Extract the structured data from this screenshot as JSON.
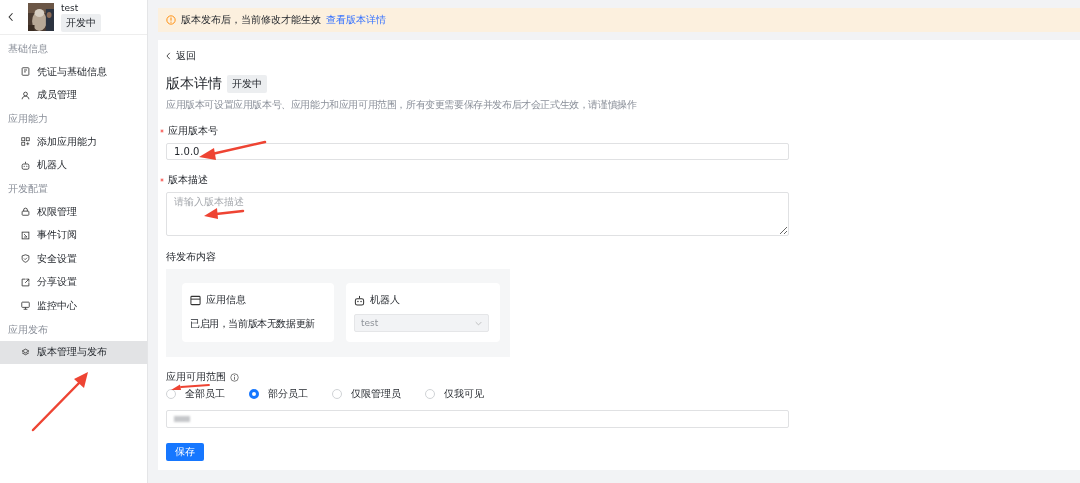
{
  "app": {
    "name": "test",
    "status": "开发中"
  },
  "sidebar": {
    "sections": [
      {
        "title": "基础信息",
        "items": [
          {
            "label": "凭证与基础信息",
            "selected": false
          },
          {
            "label": "成员管理",
            "selected": false
          }
        ]
      },
      {
        "title": "应用能力",
        "items": [
          {
            "label": "添加应用能力",
            "selected": false
          },
          {
            "label": "机器人",
            "selected": false
          }
        ]
      },
      {
        "title": "开发配置",
        "items": [
          {
            "label": "权限管理",
            "selected": false
          },
          {
            "label": "事件订阅",
            "selected": false
          },
          {
            "label": "安全设置",
            "selected": false
          },
          {
            "label": "分享设置",
            "selected": false
          },
          {
            "label": "监控中心",
            "selected": false
          }
        ]
      },
      {
        "title": "应用发布",
        "items": [
          {
            "label": "版本管理与发布",
            "selected": true
          }
        ]
      }
    ]
  },
  "banner": {
    "text": "版本发布后，当前修改才能生效",
    "link": "查看版本详情"
  },
  "back": "返回",
  "page": {
    "title": "版本详情",
    "status": "开发中",
    "description": "应用版本可设置应用版本号、应用能力和应用可用范围，所有变更需要保存并发布后才会正式生效，请谨慎操作"
  },
  "form": {
    "version": {
      "label": "应用版本号",
      "required": true,
      "value": "1.0.0"
    },
    "description": {
      "label": "版本描述",
      "required": true,
      "placeholder": "请输入版本描述"
    },
    "pending": {
      "title": "待发布内容",
      "cards": [
        {
          "kind": "info",
          "title": "应用信息",
          "text": "已启用，当前版本无数据更新"
        },
        {
          "kind": "select",
          "title": "机器人",
          "value": "test",
          "disabled": true
        }
      ]
    },
    "scope": {
      "label": "应用可用范围",
      "options": [
        {
          "label": "全部员工",
          "selected": false
        },
        {
          "label": "部分员工",
          "selected": true
        },
        {
          "label": "仅限管理员",
          "selected": false
        },
        {
          "label": "仅我可见",
          "selected": false
        }
      ]
    },
    "save": "保存"
  }
}
